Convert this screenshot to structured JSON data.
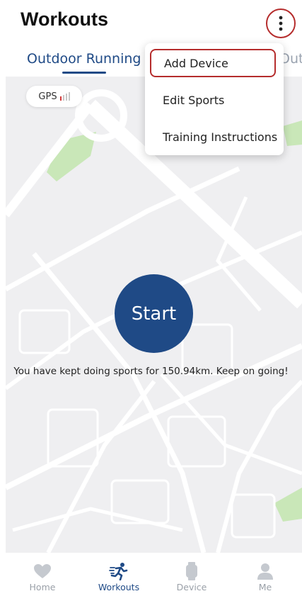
{
  "header": {
    "title": "Workouts",
    "more_icon": "more-vertical-icon"
  },
  "tabs": [
    {
      "label": "Outdoor Running",
      "active": true
    },
    {
      "label": "Outdo",
      "active": false
    }
  ],
  "gps": {
    "label": "GPS",
    "signal_level": "1/4"
  },
  "dropdown_menu": {
    "items": [
      {
        "label": "Add Device",
        "highlighted": true
      },
      {
        "label": "Edit Sports",
        "highlighted": false
      },
      {
        "label": "Training Instructions",
        "highlighted": false
      }
    ]
  },
  "start_button": {
    "label": "Start"
  },
  "summary": {
    "text": "You have kept doing sports for 150.94km. Keep on going!"
  },
  "bottom_nav": [
    {
      "label": "Home",
      "icon": "heart-icon",
      "active": false
    },
    {
      "label": "Workouts",
      "icon": "running-icon",
      "active": true
    },
    {
      "label": "Device",
      "icon": "watch-icon",
      "active": false
    },
    {
      "label": "Me",
      "icon": "person-icon",
      "active": false
    }
  ],
  "colors": {
    "primary": "#1f4a86",
    "highlight_border": "#b52c2c",
    "map_background": "#efeff1",
    "park_green": "#c9e7b8"
  }
}
